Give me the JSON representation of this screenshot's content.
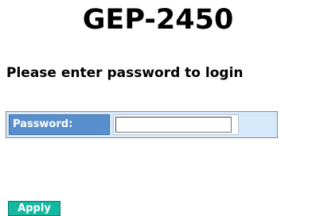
{
  "page": {
    "product_title": "GEP-2450",
    "login_prompt": "Please enter password to login"
  },
  "login_form": {
    "password_label": "Password:",
    "password_value": "",
    "password_placeholder": "",
    "apply_label": "Apply"
  },
  "colors": {
    "label_background": "#5a8fcd",
    "row_background": "#d6e9fb",
    "apply_background": "#14b8a0",
    "text_primary": "#000000",
    "label_text": "#ffffff"
  }
}
